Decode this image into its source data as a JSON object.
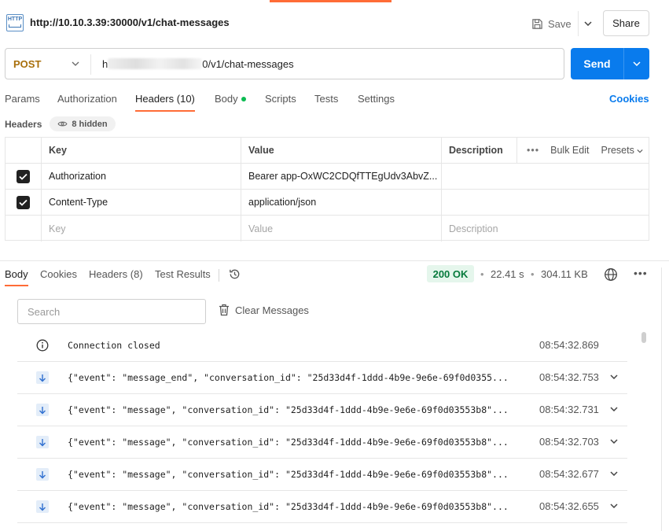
{
  "request": {
    "title": "http://10.10.3.39:30000/v1/chat-messages",
    "http_icon_text": "HTTP",
    "save_label": "Save",
    "share_label": "Share",
    "method": "POST",
    "url_prefix": "h",
    "url_suffix": "0/v1/chat-messages",
    "send_label": "Send"
  },
  "req_tabs": {
    "params": "Params",
    "authorization": "Authorization",
    "headers": "Headers",
    "headers_count": "(10)",
    "body": "Body",
    "scripts": "Scripts",
    "tests": "Tests",
    "settings": "Settings",
    "cookies": "Cookies"
  },
  "headers_section": {
    "label": "Headers",
    "hidden_pill": "8 hidden",
    "columns": {
      "key": "Key",
      "value": "Value",
      "description": "Description"
    },
    "bulk_edit": "Bulk Edit",
    "presets": "Presets",
    "rows": [
      {
        "checked": true,
        "key": "Authorization",
        "value": "Bearer app-OxWC2CDQfTTEgUdv3AbvZ...",
        "description": ""
      },
      {
        "checked": true,
        "key": "Content-Type",
        "value": "application/json",
        "description": ""
      }
    ],
    "placeholder": {
      "key": "Key",
      "value": "Value",
      "description": "Description"
    }
  },
  "response": {
    "tabs": {
      "body": "Body",
      "cookies": "Cookies",
      "headers": "Headers",
      "headers_count": "(8)",
      "test_results": "Test Results"
    },
    "status": "200 OK",
    "time": "22.41 s",
    "size": "304.11 KB",
    "search_placeholder": "Search",
    "clear_label": "Clear Messages",
    "messages": [
      {
        "type": "info",
        "text": "Connection closed",
        "time": "08:54:32.869"
      },
      {
        "type": "incoming",
        "text": "{\"event\": \"message_end\", \"conversation_id\": \"25d33d4f-1ddd-4b9e-9e6e-69f0d0355...",
        "time": "08:54:32.753"
      },
      {
        "type": "incoming",
        "text": "{\"event\": \"message\", \"conversation_id\": \"25d33d4f-1ddd-4b9e-9e6e-69f0d03553b8\"...",
        "time": "08:54:32.731"
      },
      {
        "type": "incoming",
        "text": "{\"event\": \"message\", \"conversation_id\": \"25d33d4f-1ddd-4b9e-9e6e-69f0d03553b8\"...",
        "time": "08:54:32.703"
      },
      {
        "type": "incoming",
        "text": "{\"event\": \"message\", \"conversation_id\": \"25d33d4f-1ddd-4b9e-9e6e-69f0d03553b8\"...",
        "time": "08:54:32.677"
      },
      {
        "type": "incoming",
        "text": "{\"event\": \"message\", \"conversation_id\": \"25d33d4f-1ddd-4b9e-9e6e-69f0d03553b8\"...",
        "time": "08:54:32.655"
      }
    ]
  },
  "colors": {
    "accent": "#ff6c37",
    "send": "#097bed",
    "method_post": "#a86f0b",
    "status_ok_bg": "#e5f6ec",
    "status_ok_text": "#067a3c"
  },
  "icons": [
    "http-icon",
    "save-icon",
    "chevron-down-icon",
    "eye-icon",
    "checkbox-icon",
    "more-icon",
    "history-icon",
    "globe-icon",
    "trash-icon",
    "info-icon",
    "arrow-down-icon"
  ]
}
